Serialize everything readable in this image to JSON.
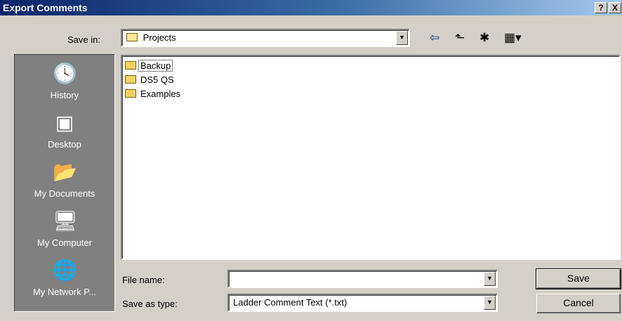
{
  "window": {
    "title": "Export Comments",
    "help_label": "?",
    "close_label": "X"
  },
  "toolbar": {
    "save_in_label": "Save in:",
    "save_in_value": "Projects",
    "back_icon": "back-arrow-icon",
    "up_icon": "up-one-level-icon",
    "new_folder_icon": "create-new-folder-icon",
    "views_icon": "view-menu-icon"
  },
  "places": [
    {
      "label": "History",
      "icon": "history-icon"
    },
    {
      "label": "Desktop",
      "icon": "desktop-icon"
    },
    {
      "label": "My Documents",
      "icon": "my-documents-icon"
    },
    {
      "label": "My Computer",
      "icon": "my-computer-icon"
    },
    {
      "label": "My Network P...",
      "icon": "my-network-places-icon"
    }
  ],
  "files": [
    {
      "name": "Backup",
      "type": "folder",
      "focused": true
    },
    {
      "name": "DS5 QS",
      "type": "folder",
      "focused": false
    },
    {
      "name": "Examples",
      "type": "folder",
      "focused": false
    }
  ],
  "form": {
    "file_name_label": "File name:",
    "file_name_value": "",
    "save_as_type_label": "Save as type:",
    "save_as_type_value": "Ladder Comment Text (*.txt)"
  },
  "buttons": {
    "save": "Save",
    "cancel": "Cancel"
  }
}
